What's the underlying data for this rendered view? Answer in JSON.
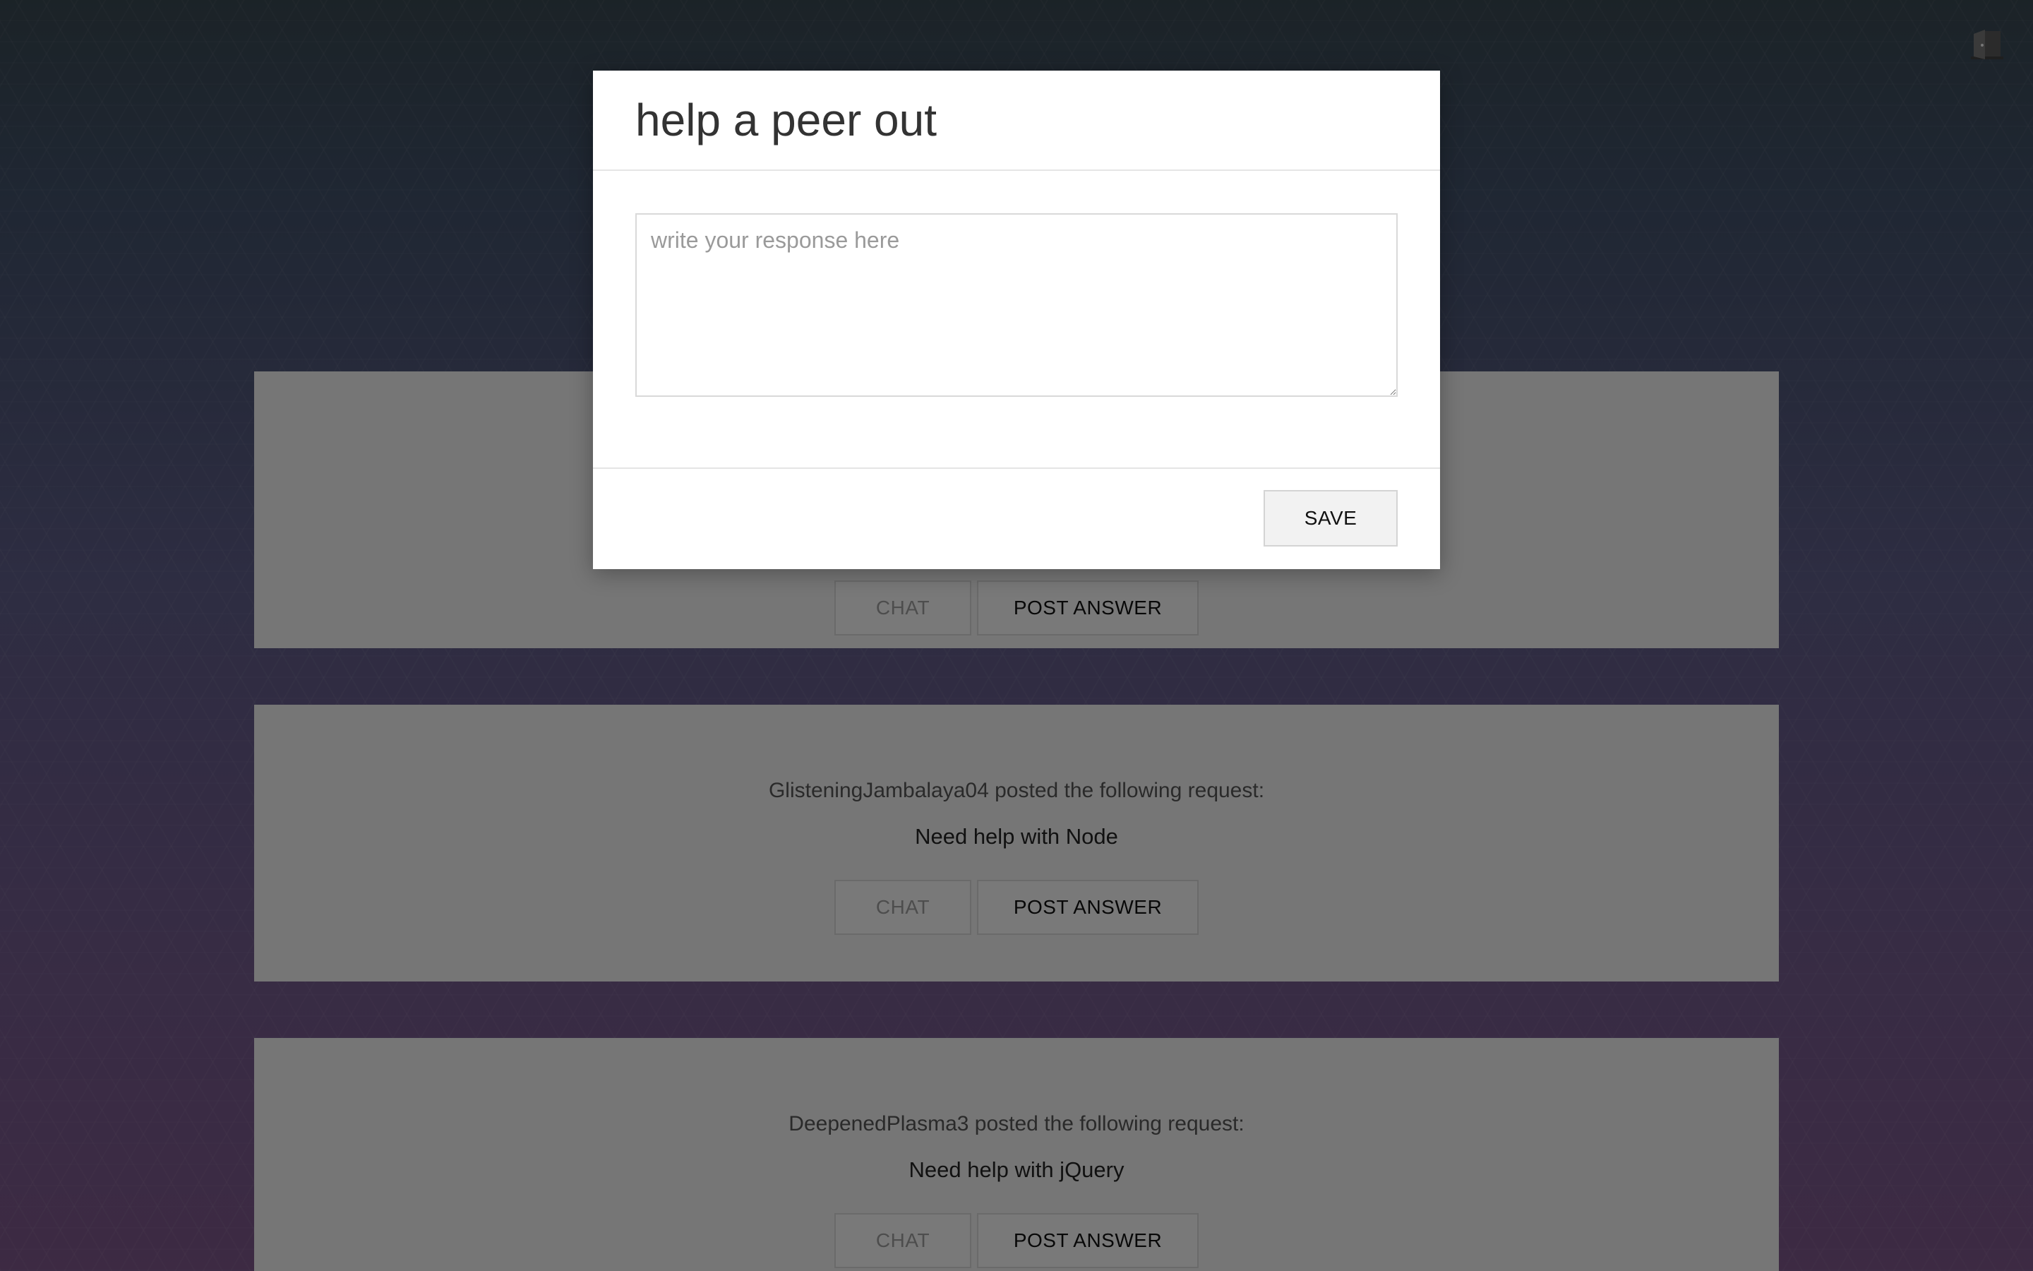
{
  "requests": [
    {
      "poster_line": "",
      "request_text": "",
      "chat_label": "CHAT",
      "post_label": "POST ANSWER"
    },
    {
      "poster_line": "GlisteningJambalaya04 posted the following request:",
      "request_text": "Need help with Node",
      "chat_label": "CHAT",
      "post_label": "POST ANSWER"
    },
    {
      "poster_line": "DeepenedPlasma3 posted the following request:",
      "request_text": "Need help with jQuery",
      "chat_label": "CHAT",
      "post_label": "POST ANSWER"
    }
  ],
  "modal": {
    "title": "help a peer out",
    "response_placeholder": "write your response here",
    "response_value": "",
    "save_label": "SAVE"
  },
  "icons": {
    "logout": "door-exit-icon"
  },
  "colors": {
    "card_background": "#ececec",
    "overlay": "rgba(0,0,0,0.5)",
    "modal_background": "#ffffff"
  }
}
